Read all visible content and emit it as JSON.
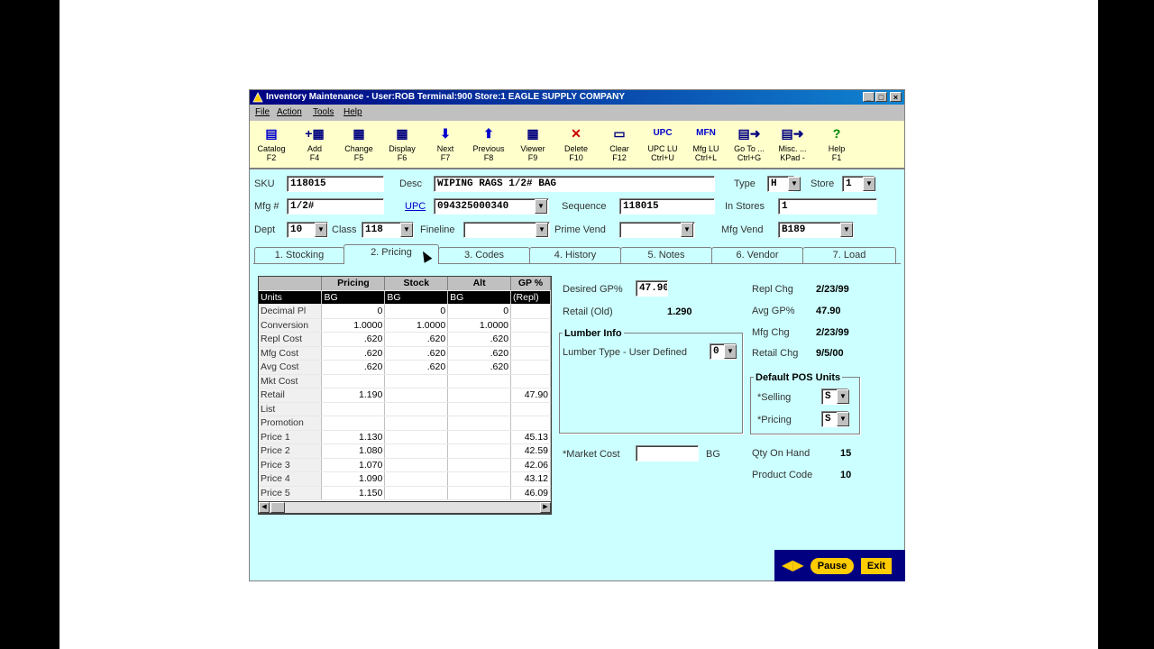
{
  "window": {
    "title": "Inventory Maintenance - User:ROB Terminal:900 Store:1 EAGLE SUPPLY COMPANY",
    "min": "_",
    "max": "□",
    "close": "×"
  },
  "menu": [
    "File",
    "Action",
    "Tools",
    "Help"
  ],
  "toolbar": [
    {
      "icon": "catalog-icon",
      "glyph": "▤",
      "color": "#0000cc",
      "l1": "Catalog",
      "l2": "F2"
    },
    {
      "icon": "add-icon",
      "glyph": "+▦",
      "color": "#000080",
      "l1": "Add",
      "l2": "F4"
    },
    {
      "icon": "change-icon",
      "glyph": "▦",
      "color": "#000080",
      "l1": "Change",
      "l2": "F5"
    },
    {
      "icon": "display-icon",
      "glyph": "▦",
      "color": "#000080",
      "l1": "Display",
      "l2": "F6"
    },
    {
      "icon": "arrow-down-icon",
      "glyph": "⬇",
      "color": "#0000cc",
      "l1": "Next",
      "l2": "F7"
    },
    {
      "icon": "arrow-up-icon",
      "glyph": "⬆",
      "color": "#0000cc",
      "l1": "Previous",
      "l2": "F8"
    },
    {
      "icon": "viewer-icon",
      "glyph": "▦",
      "color": "#000080",
      "l1": "Viewer",
      "l2": "F9"
    },
    {
      "icon": "delete-icon",
      "glyph": "✕",
      "color": "#cc0000",
      "l1": "Delete",
      "l2": "F10"
    },
    {
      "icon": "clear-icon",
      "glyph": "▭",
      "color": "#000080",
      "l1": "Clear",
      "l2": "F12"
    },
    {
      "icon": "upc-icon",
      "glyph": "UPC",
      "color": "#0000cc",
      "l1": "UPC LU",
      "l2": "Ctrl+U"
    },
    {
      "icon": "mfn-icon",
      "glyph": "MFN",
      "color": "#0000cc",
      "l1": "Mfg LU",
      "l2": "Ctrl+L"
    },
    {
      "icon": "goto-icon",
      "glyph": "▤➜",
      "color": "#000080",
      "l1": "Go To ...",
      "l2": "Ctrl+G"
    },
    {
      "icon": "misc-icon",
      "glyph": "▤➜",
      "color": "#000080",
      "l1": "Misc. ...",
      "l2": "KPad -"
    },
    {
      "icon": "help-icon",
      "glyph": "?",
      "color": "#008000",
      "l1": "Help",
      "l2": "F1"
    }
  ],
  "header": {
    "sku_label": "SKU",
    "sku": "118015",
    "desc_label": "Desc",
    "desc": "WIPING RAGS 1/2# BAG",
    "type_label": "Type",
    "type": "H",
    "store_label": "Store",
    "store": "1",
    "mfg_label": "Mfg #",
    "mfg": "1/2#",
    "upc_label": "UPC",
    "upc": "094325000340",
    "sequence_label": "Sequence",
    "sequence": "118015",
    "instores_label": "In Stores",
    "instores": "1",
    "dept_label": "Dept",
    "dept": "10",
    "class_label": "Class",
    "class": "118",
    "fineline_label": "Fineline",
    "fineline": "",
    "primevend_label": "Prime Vend",
    "primevend": "",
    "mfgvend_label": "Mfg Vend",
    "mfgvend": "B189"
  },
  "tabs": [
    "1. Stocking",
    "2. Pricing",
    "3. Codes",
    "4. History",
    "5. Notes",
    "6. Vendor",
    "7. Load"
  ],
  "grid": {
    "headers": [
      "",
      "Pricing",
      "Stock",
      "Alt",
      "GP %"
    ],
    "units": [
      "Units",
      "BG",
      "BG",
      "BG",
      "(Repl)"
    ],
    "rows": [
      [
        "Decimal Pl",
        "0",
        "0",
        "0",
        ""
      ],
      [
        "Conversion",
        "1.0000",
        "1.0000",
        "1.0000",
        ""
      ],
      [
        "Repl Cost",
        ".620",
        ".620",
        ".620",
        ""
      ],
      [
        "Mfg Cost",
        ".620",
        ".620",
        ".620",
        ""
      ],
      [
        "Avg Cost",
        ".620",
        ".620",
        ".620",
        ""
      ],
      [
        "Mkt Cost",
        "",
        "",
        "",
        ""
      ],
      [
        "Retail",
        "1.190",
        "",
        "",
        "47.90"
      ],
      [
        "List",
        "",
        "",
        "",
        ""
      ],
      [
        "Promotion",
        "",
        "",
        "",
        ""
      ],
      [
        "Price 1",
        "1.130",
        "",
        "",
        "45.13"
      ],
      [
        "Price 2",
        "1.080",
        "",
        "",
        "42.59"
      ],
      [
        "Price 3",
        "1.070",
        "",
        "",
        "42.06"
      ],
      [
        "Price 4",
        "1.090",
        "",
        "",
        "43.12"
      ],
      [
        "Price 5",
        "1.150",
        "",
        "",
        "46.09"
      ]
    ]
  },
  "pricing": {
    "desired_gp_label": "Desired GP%",
    "desired_gp": "47.90",
    "retail_old_label": "Retail (Old)",
    "retail_old": "1.290",
    "lumber_title": "Lumber Info",
    "lumber_type_label": "Lumber Type - User Defined",
    "lumber_type": "0",
    "market_cost_label": "*Market Cost",
    "market_cost": "",
    "market_cost_unit": "BG",
    "repl_chg_label": "Repl Chg",
    "repl_chg": "2/23/99",
    "avg_gp_label": "Avg GP%",
    "avg_gp": "47.90",
    "mfg_chg_label": "Mfg Chg",
    "mfg_chg": "2/23/99",
    "retail_chg_label": "Retail Chg",
    "retail_chg": "9/5/00",
    "pos_title": "Default POS Units",
    "selling_label": "*Selling",
    "selling": "S",
    "pricing_label": "*Pricing",
    "pricing_val": "S",
    "qty_label": "Qty On Hand",
    "qty": "15",
    "product_code_label": "Product Code",
    "product_code": "10"
  },
  "footer": {
    "arrows": "◀▶",
    "pause": "Pause",
    "exit": "Exit"
  }
}
